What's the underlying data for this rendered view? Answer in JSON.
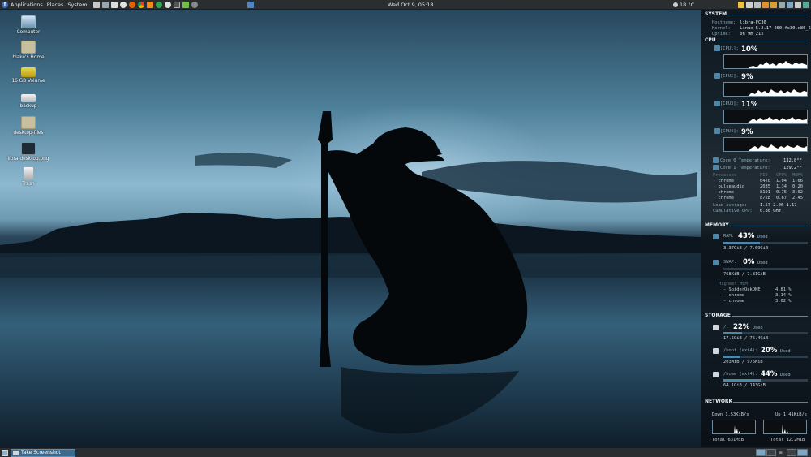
{
  "top_panel": {
    "menu": [
      "Applications",
      "Places",
      "System"
    ],
    "clock": "Wed Oct  9, 05:18",
    "weather": "18 °C"
  },
  "desktop_icons": [
    {
      "label": "Computer",
      "icon": "computer-icon"
    },
    {
      "label": "blake's Home",
      "icon": "home-folder-icon"
    },
    {
      "label": "16 GB Volume",
      "icon": "drive-icon"
    },
    {
      "label": "backup",
      "icon": "drive-icon"
    },
    {
      "label": "desktop-files",
      "icon": "folder-icon"
    },
    {
      "label": "libra-desktop.png",
      "icon": "image-file-icon"
    },
    {
      "label": "Trash",
      "icon": "trash-icon"
    }
  ],
  "conky": {
    "system": {
      "title": "SYSTEM",
      "rows": [
        {
          "k": "Hostname:",
          "v": "libra-FC30"
        },
        {
          "k": "Kernel:",
          "v": "Linux 5.2.17-200.fc30.x86_6"
        },
        {
          "k": "Uptime:",
          "v": "0h 9m 21s"
        }
      ]
    },
    "cpu": {
      "title": "CPU",
      "cores": [
        {
          "label": "CPU1",
          "pct": "10%"
        },
        {
          "label": "CPU2",
          "pct": "9%"
        },
        {
          "label": "CPU3",
          "pct": "11%"
        },
        {
          "label": "CPU4",
          "pct": "9%"
        }
      ],
      "temps": [
        {
          "k": "Core 0 Temperature:",
          "v": "132.8°F"
        },
        {
          "k": "Core 1 Temperature:",
          "v": "129.2°F"
        }
      ],
      "proc_head": {
        "name": "Processes",
        "pid": "PID",
        "cpu": "CPU%",
        "mem": "MEM%"
      },
      "processes": [
        {
          "name": "- chrome",
          "pid": "6420",
          "cpu": "1.04",
          "mem": "1.66"
        },
        {
          "name": "- pulseaudio",
          "pid": "2035",
          "cpu": "1.34",
          "mem": "0.20"
        },
        {
          "name": "- chrome",
          "pid": "8191",
          "cpu": "0.75",
          "mem": "3.02"
        },
        {
          "name": "- chrome",
          "pid": "8728",
          "cpu": "0.67",
          "mem": "2.45"
        }
      ],
      "load_k": "Load average:",
      "load_v": "1.57 2.06 1.17",
      "cumul_k": "Cumulative CPU:",
      "cumul_v": "0.80 GHz"
    },
    "memory": {
      "title": "MEMORY",
      "ram_label": "RAM:",
      "ram_pct": "43%",
      "ram_used_word": "Used",
      "ram_fraction": 0.43,
      "ram_detail": "3.37GiB / 7.69GiB",
      "swap_label": "SWAP:",
      "swap_pct": "0%",
      "swap_used_word": "Used",
      "swap_fraction": 0.0,
      "swap_detail": "768KiB / 7.81GiB",
      "highest_title": "Highest MEM",
      "highest": [
        {
          "name": "- SpiderOakONE",
          "v": "4.81 %"
        },
        {
          "name": "- chrome",
          "v": "3.14 %"
        },
        {
          "name": "- chrome",
          "v": "3.02 %"
        }
      ]
    },
    "storage": {
      "title": "STORAGE",
      "mounts": [
        {
          "label": "/:",
          "pct": "22%",
          "used": "Used",
          "fraction": 0.22,
          "detail": "17.5GiB / 76.4GiB"
        },
        {
          "label": "/boot (ext4):",
          "pct": "20%",
          "used": "Used",
          "fraction": 0.2,
          "detail": "203MiB / 976MiB"
        },
        {
          "label": "/home (ext4):",
          "pct": "44%",
          "used": "Used",
          "fraction": 0.44,
          "detail": "64.1GiB / 143GiB"
        }
      ]
    },
    "network": {
      "title": "NETWORK",
      "down": "Down 1.53KiB/s",
      "up": "Up 1.41KiB/s",
      "total_down": "Total  631MiB",
      "total_up": "Total 12.2MiB"
    }
  },
  "bottom_panel": {
    "task_label": "Take Screenshot"
  },
  "colors": {
    "accent": "#4f87a8",
    "panel": "#2b2e31"
  }
}
